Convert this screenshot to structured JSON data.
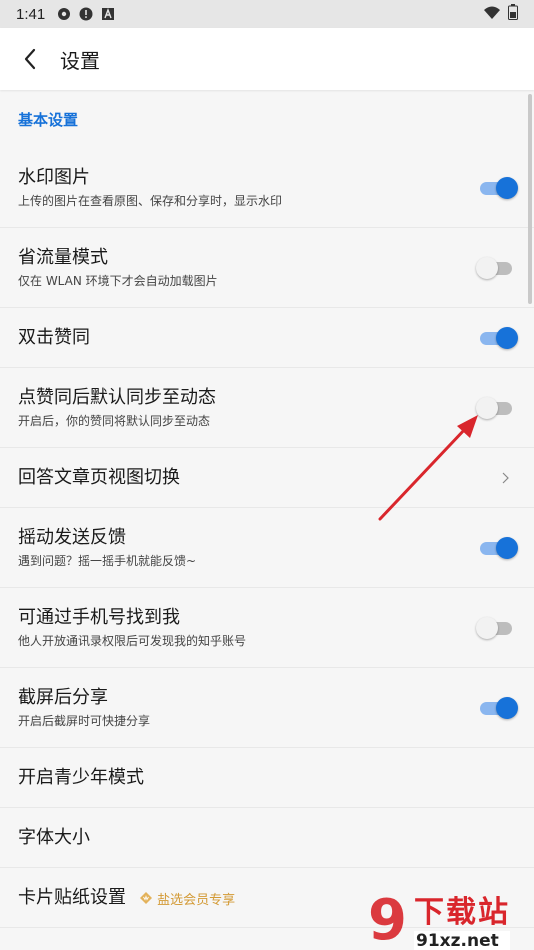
{
  "status_bar": {
    "time": "1:41",
    "icons": [
      "settings-gear-icon",
      "alert-icon",
      "app-a-icon"
    ],
    "right_icons": [
      "wifi-icon",
      "battery-icon"
    ]
  },
  "app_bar": {
    "back_icon": "chevron-left-icon",
    "title": "设置"
  },
  "section": {
    "title": "基本设置"
  },
  "items": [
    {
      "title": "水印图片",
      "subtitle": "上传的图片在查看原图、保存和分享时，显示水印",
      "control": "toggle",
      "on": true
    },
    {
      "title": "省流量模式",
      "subtitle": "仅在 WLAN 环境下才会自动加载图片",
      "control": "toggle",
      "on": false
    },
    {
      "title": "双击赞同",
      "subtitle": "",
      "control": "toggle",
      "on": true
    },
    {
      "title": "点赞同后默认同步至动态",
      "subtitle": "开启后，你的赞同将默认同步至动态",
      "control": "toggle",
      "on": false
    },
    {
      "title": "回答文章页视图切换",
      "subtitle": "",
      "control": "chevron"
    },
    {
      "title": "摇动发送反馈",
      "subtitle": "遇到问题？摇一摇手机就能反馈~",
      "control": "toggle",
      "on": true
    },
    {
      "title": "可通过手机号找到我",
      "subtitle": "他人开放通讯录权限后可发现我的知乎账号",
      "control": "toggle",
      "on": false
    },
    {
      "title": "截屏后分享",
      "subtitle": "开启后截屏时可快捷分享",
      "control": "toggle",
      "on": true
    },
    {
      "title": "开启青少年模式",
      "subtitle": "",
      "control": "none"
    },
    {
      "title": "字体大小",
      "subtitle": "",
      "control": "none"
    },
    {
      "title": "卡片贴纸设置",
      "subtitle": "",
      "control": "badge",
      "badge": "盐选会员专享"
    }
  ],
  "watermark": {
    "logo": "9",
    "brand": "下载站",
    "url": "91xz.net"
  },
  "colors": {
    "accent": "#1772d9",
    "toggle_on_track": "#8ab6ef",
    "toggle_off_track": "#bdbdbd",
    "vip_gold": "#d39a35",
    "annotation_arrow": "#d9262c"
  }
}
